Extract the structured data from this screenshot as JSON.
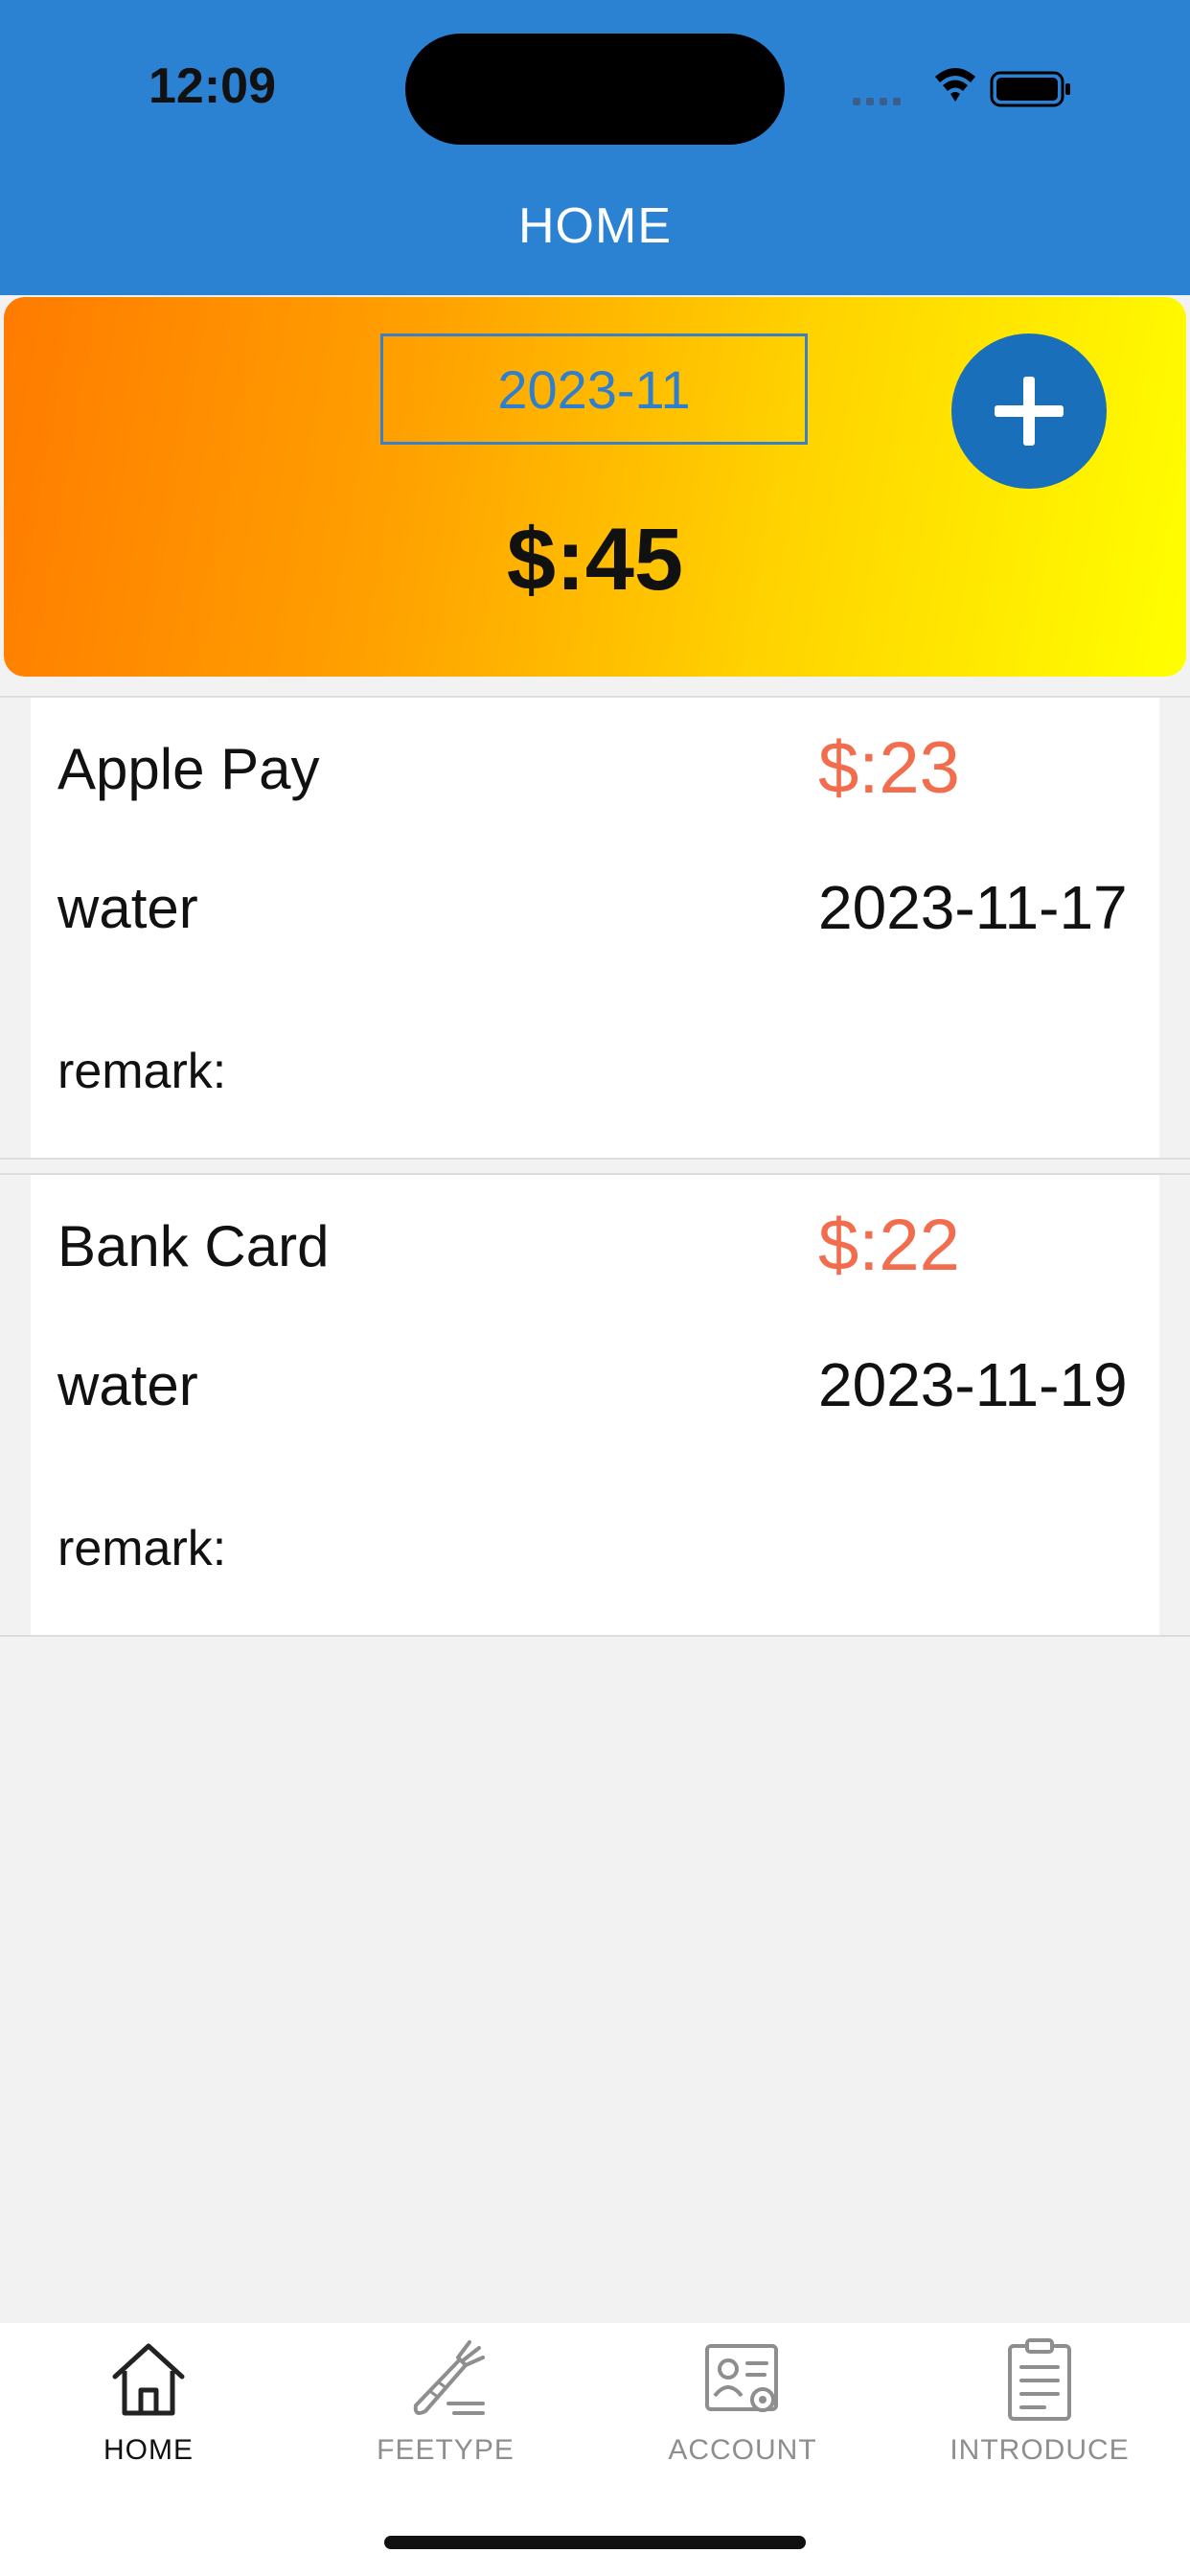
{
  "status_bar": {
    "time": "12:09",
    "icons": [
      "cellular-icon",
      "wifi-icon",
      "battery-icon"
    ]
  },
  "header": {
    "title": "HOME"
  },
  "summary": {
    "month": "2023-11",
    "total": "$:45",
    "add_icon": "plus-icon"
  },
  "records": [
    {
      "account": "Apple Pay",
      "amount": "$:23",
      "type": "water",
      "date": "2023-11-17",
      "remark_label": "remark:"
    },
    {
      "account": "Bank Card",
      "amount": "$:22",
      "type": "water",
      "date": "2023-11-19",
      "remark_label": "remark:"
    }
  ],
  "tabs": [
    {
      "label": "HOME",
      "icon": "house-icon",
      "active": true
    },
    {
      "label": "FEETYPE",
      "icon": "carrot-icon",
      "active": false
    },
    {
      "label": "ACCOUNT",
      "icon": "account-card-icon",
      "active": false
    },
    {
      "label": "INTRODUCE",
      "icon": "clipboard-icon",
      "active": false
    }
  ],
  "colors": {
    "header": "#2b81d2",
    "amount": "#f26d4d",
    "add_button": "#1a6fba",
    "tab_active": "#111111",
    "tab_inactive": "#8e8e8e"
  }
}
